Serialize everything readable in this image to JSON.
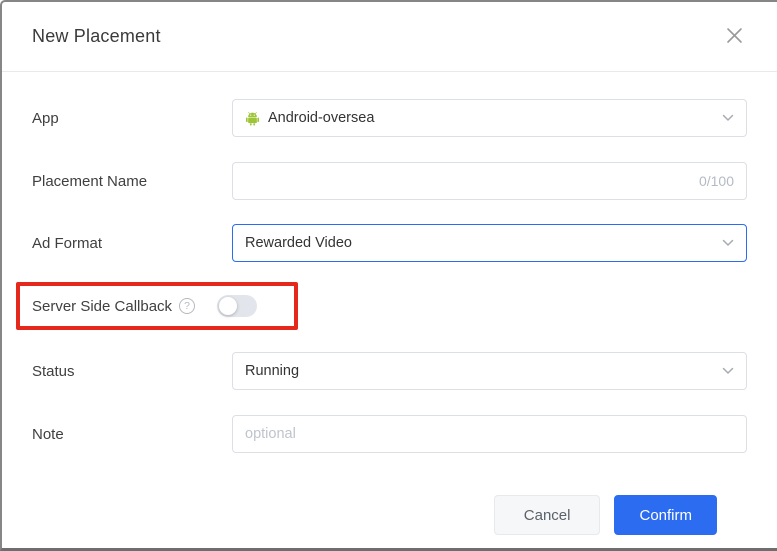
{
  "dialog": {
    "title": "New Placement"
  },
  "form": {
    "app": {
      "label": "App",
      "value": "Android-oversea",
      "icon": "android-icon"
    },
    "placement_name": {
      "label": "Placement Name",
      "value": "",
      "counter": "0/100"
    },
    "ad_format": {
      "label": "Ad Format",
      "value": "Rewarded Video",
      "focused": true
    },
    "server_side_callback": {
      "label": "Server Side Callback",
      "help_icon": "?",
      "toggle_state": "off",
      "annotated": true
    },
    "status": {
      "label": "Status",
      "value": "Running"
    },
    "note": {
      "label": "Note",
      "value": "",
      "placeholder": "optional"
    }
  },
  "footer": {
    "cancel_label": "Cancel",
    "confirm_label": "Confirm"
  },
  "colors": {
    "accent_blue": "#2b6cf0",
    "annotation_red": "#e4281b",
    "android_green": "#9ec437",
    "border_gray": "#dcdfe6"
  }
}
